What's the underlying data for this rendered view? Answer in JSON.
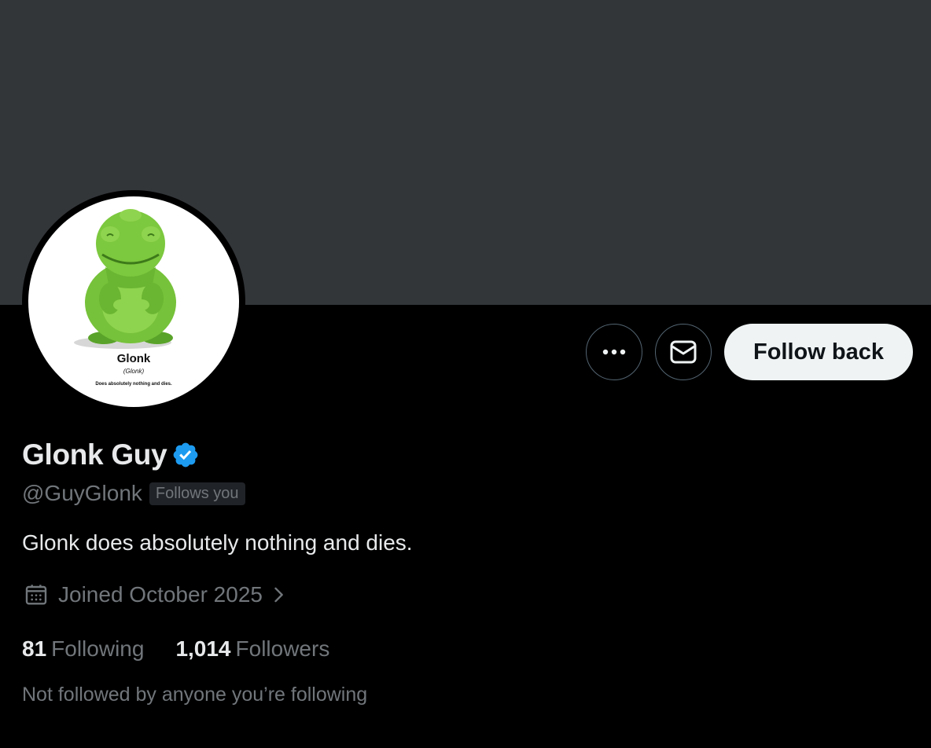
{
  "colors": {
    "banner": "#333639",
    "background": "#000000",
    "primary_text": "#e7e9ea",
    "secondary_text": "#71767b",
    "verified": "#1d9bf0",
    "follow_button_bg": "#eff3f4"
  },
  "avatar": {
    "caption_title": "Glonk",
    "caption_subtitle": "(Glonk)",
    "caption_desc": "Does absolutely nothing and dies."
  },
  "actions": {
    "more_icon": "more-horizontal-icon",
    "message_icon": "envelope-icon",
    "follow_label": "Follow back"
  },
  "profile": {
    "display_name": "Glonk Guy",
    "verified_icon": "verified-badge-icon",
    "handle": "@GuyGlonk",
    "follows_you": "Follows you",
    "bio": "Glonk does absolutely nothing and dies.",
    "joined": "Joined October 2025",
    "calendar_icon": "calendar-icon",
    "chevron_icon": "chevron-right-icon"
  },
  "stats": {
    "following_count": "81",
    "following_label": "Following",
    "followers_count": "1,014",
    "followers_label": "Followers"
  },
  "mutuals": "Not followed by anyone you’re following"
}
